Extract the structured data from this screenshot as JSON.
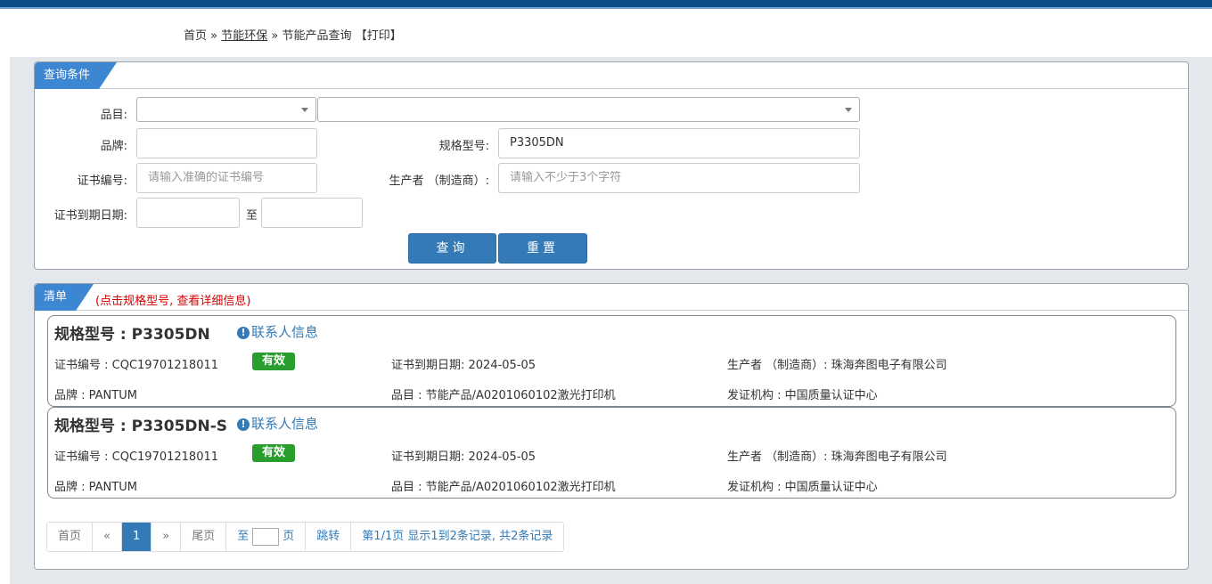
{
  "breadcrumb": {
    "home": "首页",
    "sep1": "»",
    "section": "节能环保",
    "sep2": "»",
    "current": "节能产品查询",
    "print": "【打印】"
  },
  "query": {
    "title": "查询条件",
    "category_label": "品目:",
    "brand_label": "品牌:",
    "model_label": "规格型号:",
    "model_value": "P3305DN",
    "cert_no_label": "证书编号:",
    "cert_no_placeholder": "请输入准确的证书编号",
    "maker_label": "生产者 （制造商）:",
    "maker_placeholder": "请输入不少于3个字符",
    "expiry_label": "证书到期日期:",
    "to": "至",
    "search_btn": "查询",
    "reset_btn": "重置"
  },
  "list": {
    "title": "清单",
    "hint": "(点击规格型号, 查看详细信息)",
    "items": [
      {
        "title": "规格型号 : P3305DN",
        "contact": "联系人信息",
        "cert": "证书编号 : CQC19701218011",
        "status": "有效",
        "expiry": "证书到期日期: 2024-05-05",
        "maker": "生产者 （制造商）: 珠海奔图电子有限公司",
        "brand": "品牌 : PANTUM",
        "category": "品目 : 节能产品/A0201060102激光打印机",
        "issuer": "发证机构 : 中国质量认证中心"
      },
      {
        "title": "规格型号 : P3305DN-S",
        "contact": "联系人信息",
        "cert": "证书编号 : CQC19701218011",
        "status": "有效",
        "expiry": "证书到期日期: 2024-05-05",
        "maker": "生产者 （制造商）: 珠海奔图电子有限公司",
        "brand": "品牌 : PANTUM",
        "category": "品目 : 节能产品/A0201060102激光打印机",
        "issuer": "发证机构 : 中国质量认证中心"
      }
    ]
  },
  "pager": {
    "first": "首页",
    "prev": "«",
    "page": "1",
    "next": "»",
    "last": "尾页",
    "goto_pre": "至",
    "goto_post": "页",
    "jump": "跳转",
    "summary": "第1/1页  显示1到2条记录, 共2条记录"
  },
  "colors": {
    "accent": "#337ab7",
    "topbar": "#0b4f8a",
    "valid": "#2a9d2f",
    "hint": "#d80000"
  }
}
